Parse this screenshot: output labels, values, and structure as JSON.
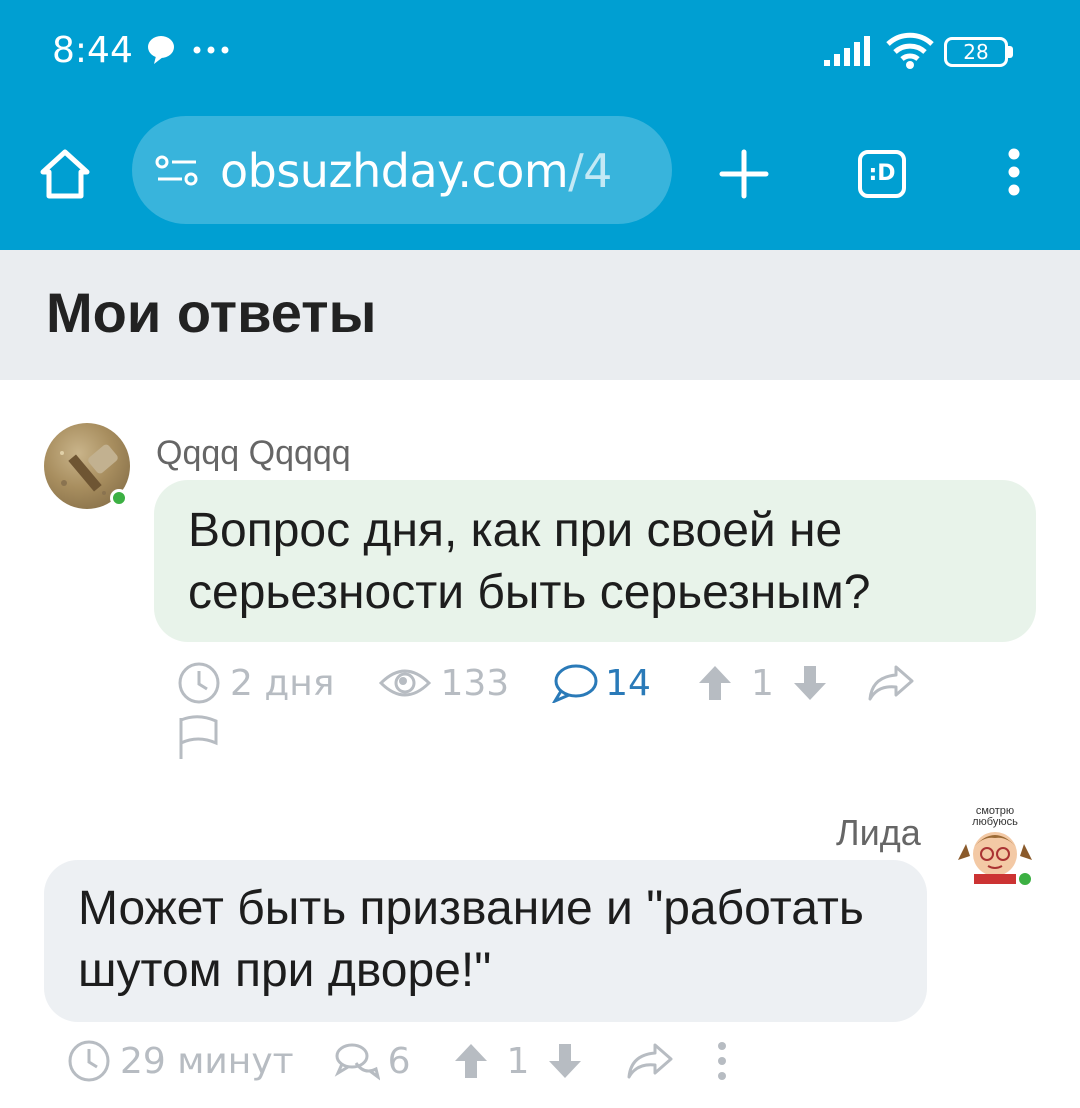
{
  "status_bar": {
    "time": "8:44",
    "battery": "28"
  },
  "browser": {
    "url_host": "obsuzhday.com",
    "url_path": "/4",
    "tabs_label": ":D"
  },
  "page": {
    "title": "Мои ответы"
  },
  "comments": [
    {
      "author": "Qqqq Qqqqq",
      "text": "Вопрос дня, как при своей не серьезности быть серьезным?",
      "age": "2 дня",
      "views": "133",
      "replies": "14",
      "score": "1"
    },
    {
      "author": "Лида",
      "avatar_caption": "смотрю любуюсь",
      "text": "Может быть призвание и \"работать шутом при дворе!\"",
      "age": "29 минут",
      "replies": "6",
      "score": "1"
    }
  ],
  "colors": {
    "chrome": "#009fd2",
    "bubble_mine": "#e8f3ea",
    "bubble_other": "#edf0f3",
    "online": "#3cb043",
    "link": "#2a7ab8"
  }
}
